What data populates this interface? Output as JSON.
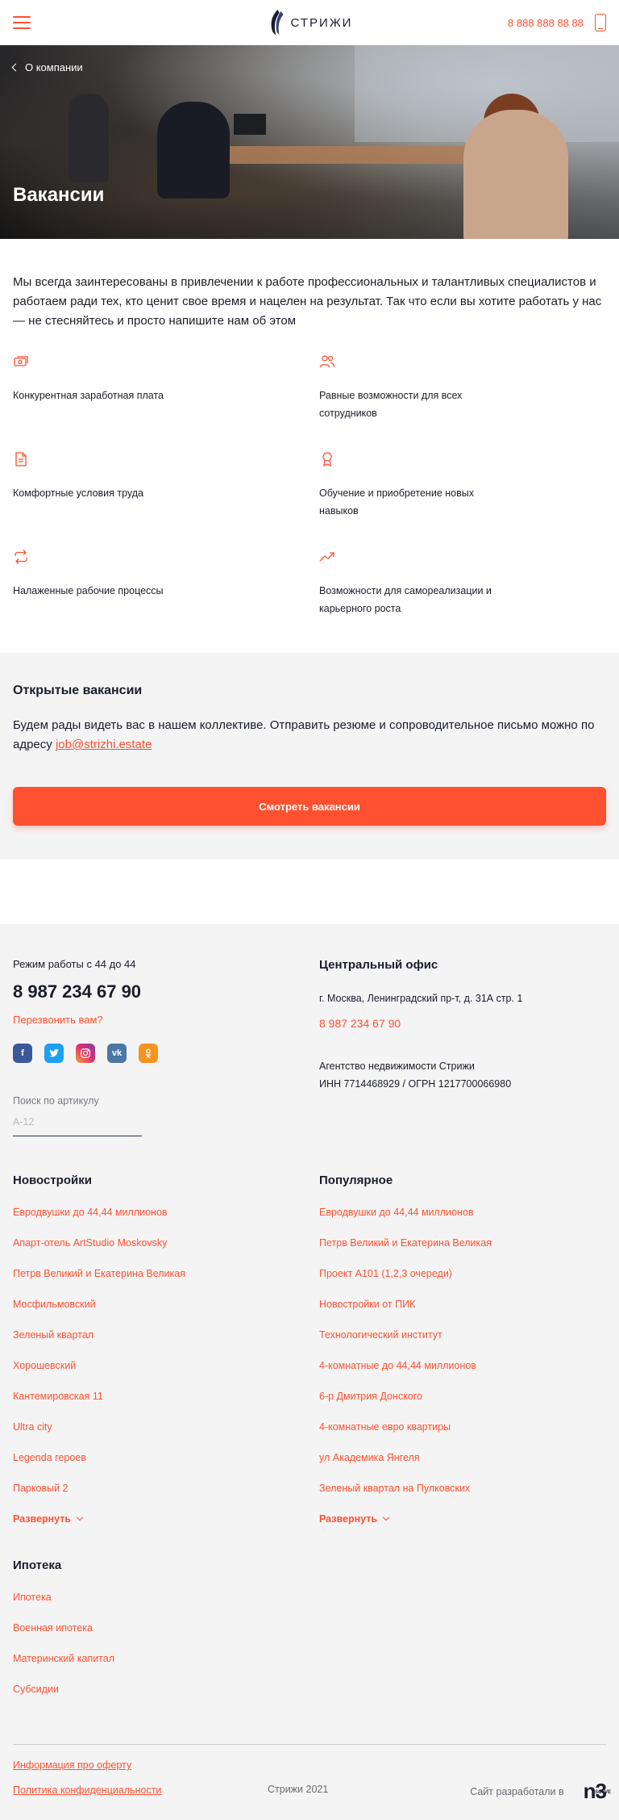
{
  "header": {
    "logo_text": "СТРИЖИ",
    "phone": "8 888 888 88 88"
  },
  "hero": {
    "back_label": "О компании",
    "title": "Вакансии"
  },
  "intro": {
    "text": "Мы всегда заинтересованы в привлечении к работе профессиональных и талантливых специалистов и работаем ради тех, кто ценит свое время и нацелен на результат. Так что если вы хотите работать у нас — не стесняйтесь и просто напишите нам об этом"
  },
  "features": [
    {
      "icon": "money-icon",
      "text": "Конкурентная заработная плата"
    },
    {
      "icon": "users-icon",
      "text": "Равные возможности для всех сотрудников"
    },
    {
      "icon": "document-icon",
      "text": "Комфортные условия труда"
    },
    {
      "icon": "award-icon",
      "text": "Обучение и приобретение новых навыков"
    },
    {
      "icon": "repeat-icon",
      "text": "Налаженные рабочие процессы"
    },
    {
      "icon": "trending-up-icon",
      "text": "Возможности для самореализации и карьерного роста"
    }
  ],
  "vacancies": {
    "title": "Открытые вакансии",
    "text": "Будем рады видеть вас в нашем коллективе. Отправить резюме и сопроводительное письмо можно по адресу ",
    "email": "job@strizhi.estate",
    "button": "Смотреть вакансии"
  },
  "footer": {
    "work_hours": "Режим работы с 44 до 44",
    "phone": "8 987 234 67 90",
    "callback": "Перезвонить вам?",
    "socials": [
      "facebook-icon",
      "twitter-icon",
      "instagram-icon",
      "vk-icon",
      "odnoklassniki-icon"
    ],
    "search_label": "Поиск по артикулу",
    "search_placeholder": "А-12",
    "office_title": "Центральный офис",
    "office_address": "г. Москва, Ленинградский пр-т, д. 31А стр. 1",
    "office_phone": "8 987 234 67 90",
    "agency_name": "Агентство недвижимости Стрижи",
    "agency_ids": "ИНН  7714468929 / ОГРН 1217700066980",
    "new_buildings": {
      "title": "Новостройки",
      "links": [
        "Евродвушки до 44,44 миллионов",
        "Апарт-отель ArtStudio Moskovsky",
        "Петрв Великий и Екатерина Великая",
        "Мосфильмовский",
        "Зеленый квартал",
        "Хорошевский",
        "Кантемировская 11",
        "Ultra city",
        "Legenda героев",
        "Парковый 2"
      ],
      "expand": "Развернуть"
    },
    "popular": {
      "title": "Популярное",
      "links": [
        "Евродвушки до 44,44 миллионов",
        "Петрв Великий и Екатерина Великая",
        "Проект А101 (1,2,3 очереди)",
        "Новостройки от ПИК",
        "Технологический институт",
        "4-комнатные до 44,44 миллионов",
        "6-р Дмитрия Донского",
        "4-комнатные евро квартиры",
        "ул Академика Янгеля",
        "Зеленый квартал на Пулковских"
      ],
      "expand": "Развернуть"
    },
    "mortgage": {
      "title": "Ипотека",
      "links": [
        "Ипотека",
        "Военная ипотека",
        "Материнский капитал",
        "Субсидии"
      ]
    },
    "offer_link": "Информация про оферту",
    "privacy_link": "Политика конфиденциальности",
    "copyright": "Стрижи 2021",
    "developed_by": "Сайт разработали в",
    "dev_logo": "n3",
    "dev_logo_sub": "SOLVE"
  },
  "colors": {
    "accent": "#ff5030",
    "text": "#1b1d2c",
    "panel_bg": "#f4f4f4"
  }
}
